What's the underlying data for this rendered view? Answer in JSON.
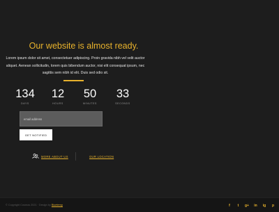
{
  "hero": {
    "title": "Our website is almost ready.",
    "lead": "Lorem ipsum dolor sit amet, consectetuer adipiscing. Proin gravida nibh vel velit auctor aliquet. Aenean sollicitudin, lorem quis bibendum auctor, nisi elit consequat ipsum, nec sagittis sem nibh id elit. Duis sed odio sit."
  },
  "countdown": {
    "days": {
      "value": "134",
      "label": "DAYS"
    },
    "hours": {
      "value": "12",
      "label": "HOURS"
    },
    "minutes": {
      "value": "50",
      "label": "MINUTES"
    },
    "seconds": {
      "value": "33",
      "label": "SECONDS"
    }
  },
  "subscribe": {
    "placeholder": "email address",
    "button_label": "GET NOTIFIED"
  },
  "links": {
    "about": "MORE ABOUT US",
    "location": "OUR LOCATION"
  },
  "footer": {
    "copyright": "© Copyright Cosmos 2021 · Design by",
    "credit": "Bluetemp"
  },
  "social": {
    "facebook": "f",
    "twitter": "t",
    "google_plus": "g+",
    "linkedin": "in",
    "instagram": "ig",
    "pinterest": "p"
  },
  "colors": {
    "accent": "#e8b22c",
    "background": "#1d1d1d",
    "footer": "#151515"
  }
}
